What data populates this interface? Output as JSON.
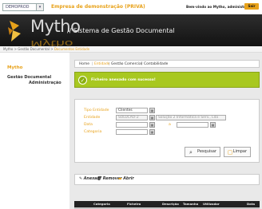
{
  "topbar": {
    "company_select": "DEMOPROD",
    "company_name": "Empresa de demonstração (PRIVA)",
    "welcome": "Bem-vindo ao Mytho, administrador",
    "exit_label": "Sair"
  },
  "header": {
    "logo": "Mytho",
    "title": "// Sistema de Gestão Documental"
  },
  "breadcrumb": {
    "path": "Mytho > Gestão Documental > ",
    "current": "Documentos Entidade"
  },
  "sidebar": {
    "title": "Mytho",
    "items": [
      {
        "label": "Gestão Documental"
      },
      {
        "label": "Administração"
      }
    ]
  },
  "tabs": [
    {
      "label": "Home"
    },
    {
      "label": "Entidade"
    },
    {
      "label": "Gestão Comercial"
    },
    {
      "label": "Contabilidade"
    }
  ],
  "notice": {
    "text": "Ficheiro anexado com sucesso!"
  },
  "form": {
    "tipo_label": "Tipo Entidade",
    "tipo_value": "Clientes",
    "entidade_label": "Entidade",
    "entidade_code": "SOLUCAO-2",
    "entidade_name": "Solução 2 Informática e Serv., Lda",
    "data_label": "Data",
    "data_sep": "a",
    "categoria_label": "Categoria",
    "search_label": "Pesquisar",
    "clear_label": "Limpar"
  },
  "actions": {
    "attach": "Anexar",
    "remove": "Remover",
    "open": "Abrir"
  },
  "grid": {
    "columns": [
      "Categoria",
      "Ficheiro",
      "Descrição",
      "Tamanho",
      "Utilizador",
      "Data"
    ]
  },
  "colors": {
    "accent": "#e8a21a",
    "success": "#a8c820",
    "header_bg": "#1c1c1c"
  }
}
